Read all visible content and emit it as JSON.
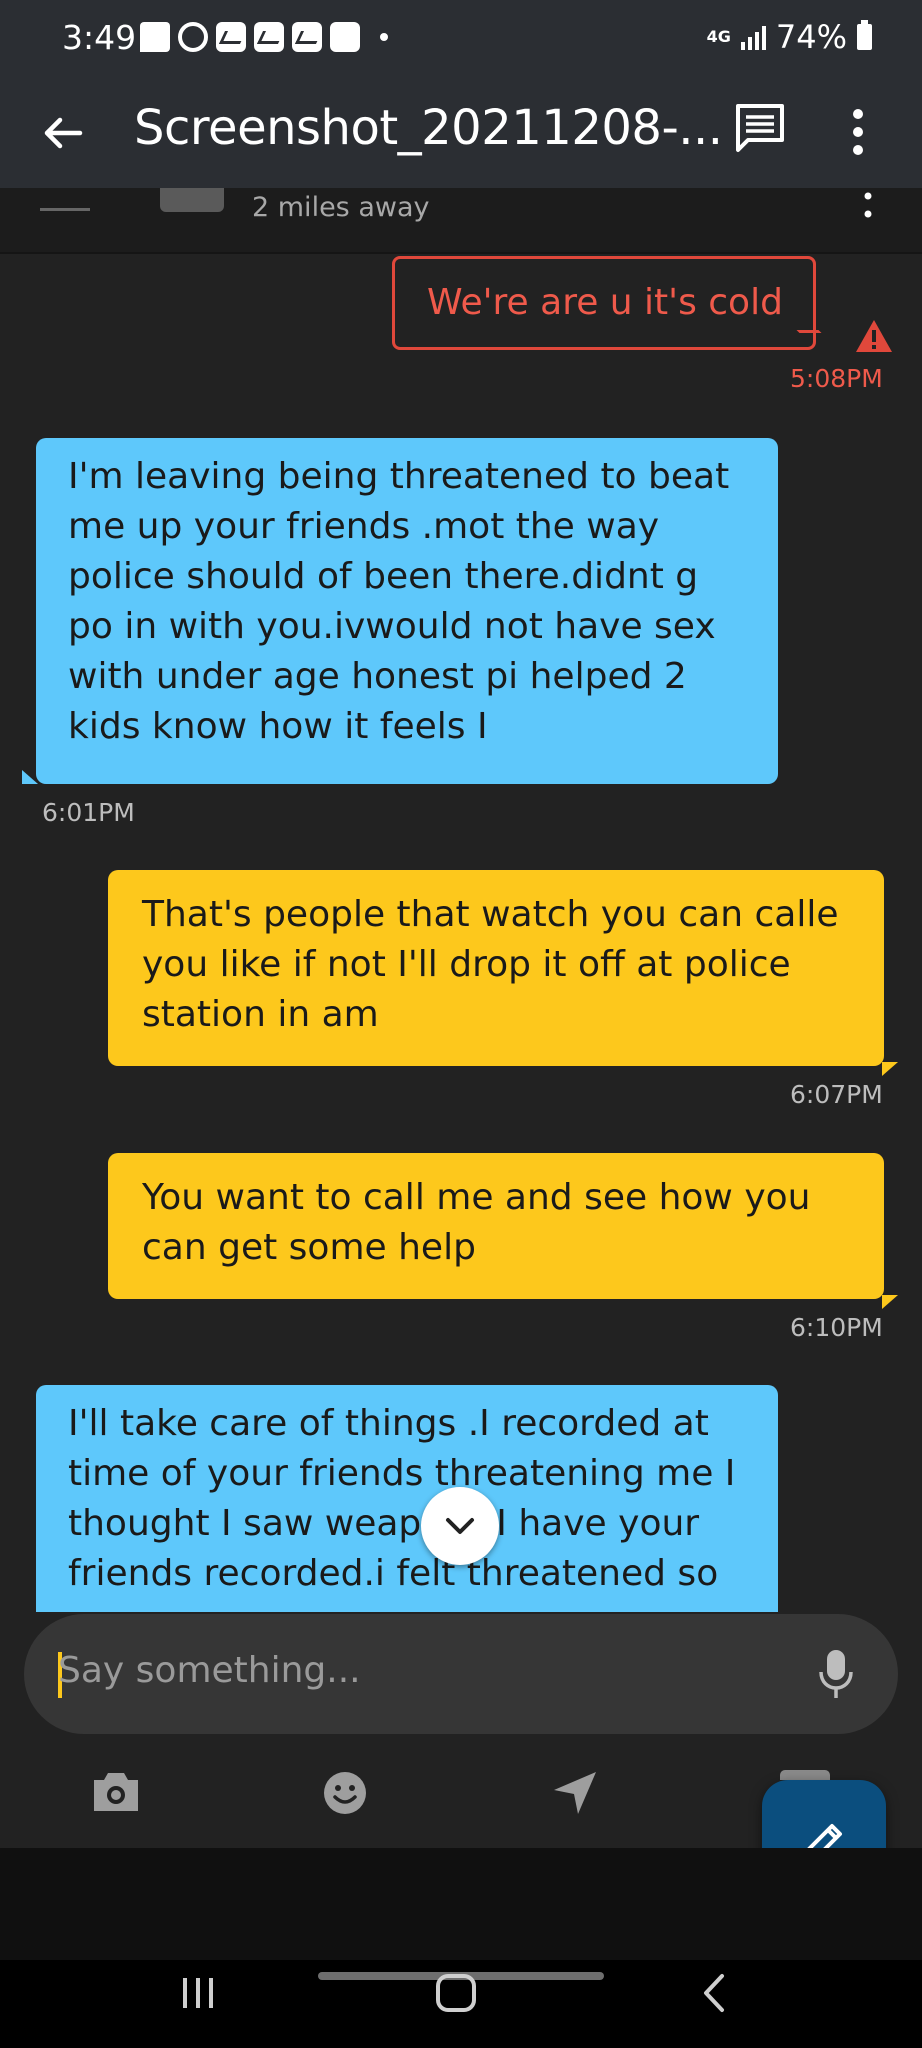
{
  "status_bar": {
    "time": "3:49",
    "network": "4G",
    "battery": "74%"
  },
  "toolbar": {
    "title": "Screenshot_20211208-..."
  },
  "chat_header": {
    "distance": "2 miles away"
  },
  "messages": [
    {
      "side": "right",
      "status": "failed",
      "text": "We're are u it's cold",
      "time": "5:08PM"
    },
    {
      "side": "left",
      "text": "I'm leaving being threatened  to beat me up your friends .mot the way police should of been there.didnt g po in with you.ivwould not have sex with under age honest pi helped 2 kids know how it feels I",
      "time": "6:01PM"
    },
    {
      "side": "right",
      "text": "That's people that watch you can calle you like if not I'll drop it off at police station in am",
      "time": "6:07PM"
    },
    {
      "side": "right",
      "text": "You want to call me and see how you can get some help",
      "time": "6:10PM"
    },
    {
      "side": "left",
      "text": "I'll  take care of things .I recorded  at time of your friends  threatening me I thought I saw weapons I have your friends recorded.i felt threatened  so",
      "time": ""
    }
  ],
  "composer": {
    "placeholder": "Say something..."
  },
  "colors": {
    "incoming_bubble": "#5ec8fb",
    "outgoing_bubble": "#fdc81c",
    "error": "#ef5a4b",
    "fab": "#0b4e7e"
  },
  "icons": [
    "back-arrow-icon",
    "message-icon",
    "more-vert-icon",
    "warning-icon",
    "chevron-down-icon",
    "microphone-icon",
    "camera-icon",
    "smiley-icon",
    "location-arrow-icon",
    "pencil-icon"
  ]
}
